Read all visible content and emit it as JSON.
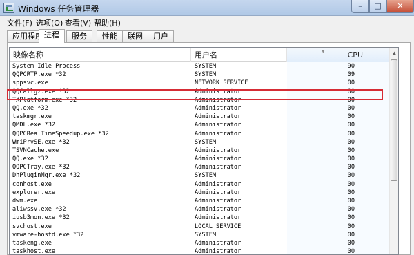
{
  "window": {
    "title": "Windows 任务管理器",
    "controls": {
      "minimize": "–",
      "maximize": "□",
      "close": "✕"
    }
  },
  "menu": [
    "文件(F)",
    "选项(O)",
    "查看(V)",
    "帮助(H)"
  ],
  "tabs": [
    "应用程序",
    "进程",
    "服务",
    "性能",
    "联网",
    "用户"
  ],
  "active_tab": "进程",
  "columns": {
    "name": "映像名称",
    "user": "用户名",
    "cpu": "CPU"
  },
  "processes": [
    {
      "name": "System Idle Process",
      "user": "SYSTEM",
      "cpu": "90"
    },
    {
      "name": "QQPCRTP.exe *32",
      "user": "SYSTEM",
      "cpu": "09"
    },
    {
      "name": "sppsvc.exe",
      "user": "NETWORK SERVICE",
      "cpu": "00"
    },
    {
      "name": "QQCallgz.exe *32",
      "user": "Administrator",
      "cpu": "00"
    },
    {
      "name": "TXPlatform.exe *32",
      "user": "Administrator",
      "cpu": "00"
    },
    {
      "name": "QQ.exe *32",
      "user": "Administrator",
      "cpu": "00"
    },
    {
      "name": "taskmgr.exe",
      "user": "Administrator",
      "cpu": "00"
    },
    {
      "name": "QMDL.exe *32",
      "user": "Administrator",
      "cpu": "00"
    },
    {
      "name": "QQPCRealTimeSpeedup.exe *32",
      "user": "Administrator",
      "cpu": "00"
    },
    {
      "name": "WmiPrvSE.exe *32",
      "user": "SYSTEM",
      "cpu": "00"
    },
    {
      "name": "TSVNCache.exe",
      "user": "Administrator",
      "cpu": "00"
    },
    {
      "name": "QQ.exe *32",
      "user": "Administrator",
      "cpu": "00"
    },
    {
      "name": "QQPCTray.exe *32",
      "user": "Administrator",
      "cpu": "00"
    },
    {
      "name": "DhPluginMgr.exe *32",
      "user": "SYSTEM",
      "cpu": "00"
    },
    {
      "name": "conhost.exe",
      "user": "Administrator",
      "cpu": "00"
    },
    {
      "name": "explorer.exe",
      "user": "Administrator",
      "cpu": "00"
    },
    {
      "name": "dwm.exe",
      "user": "Administrator",
      "cpu": "00"
    },
    {
      "name": "aliwssv.exe *32",
      "user": "Administrator",
      "cpu": "00"
    },
    {
      "name": "iusb3mon.exe *32",
      "user": "Administrator",
      "cpu": "00"
    },
    {
      "name": "svchost.exe",
      "user": "LOCAL SERVICE",
      "cpu": "00"
    },
    {
      "name": "vmware-hostd.exe *32",
      "user": "SYSTEM",
      "cpu": "00"
    },
    {
      "name": "taskeng.exe",
      "user": "Administrator",
      "cpu": "00"
    },
    {
      "name": "taskhost.exe",
      "user": "Administrator",
      "cpu": "00"
    }
  ],
  "highlight_color": "#d62c35"
}
